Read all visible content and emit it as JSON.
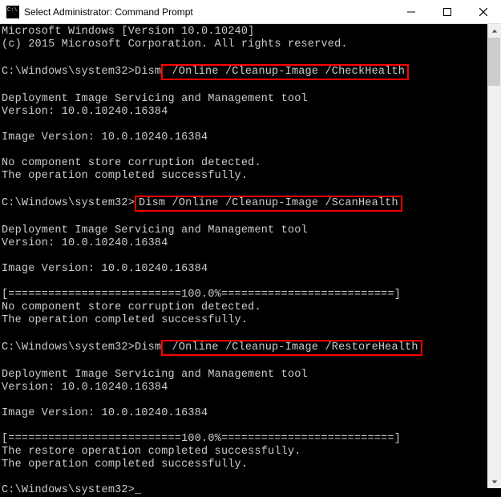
{
  "window": {
    "title": "Select Administrator: Command Prompt"
  },
  "terminal": {
    "line_os": "Microsoft Windows [Version 10.0.10240]",
    "line_copyright": "(c) 2015 Microsoft Corporation. All rights reserved.",
    "prompt1_prefix": "C:\\Windows\\system32>Dism",
    "prompt1_boxed": " /Online /Cleanup-Image /CheckHealth",
    "tool_header": "Deployment Image Servicing and Management tool",
    "tool_version": "Version: 10.0.10240.16384",
    "image_version": "Image Version: 10.0.10240.16384",
    "no_corruption": "No component store corruption detected.",
    "op_success": "The operation completed successfully.",
    "prompt2_prefix": "C:\\Windows\\system32>",
    "prompt2_boxed": "Dism /Online /Cleanup-Image /ScanHealth",
    "progress_line": "[==========================100.0%==========================]",
    "prompt3_prefix": "C:\\Windows\\system32>Dism",
    "prompt3_boxed": " /Online /Cleanup-Image /RestoreHealth",
    "restore_success": "The restore operation completed successfully.",
    "final_prompt": "C:\\Windows\\system32>",
    "cursor": "_"
  }
}
